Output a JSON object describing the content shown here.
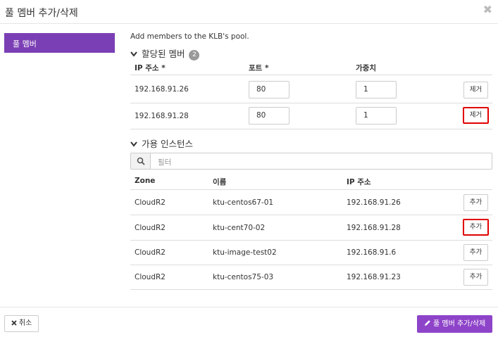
{
  "dialog": {
    "title": "풀 멤버 추가/삭제",
    "close_glyph": "✖",
    "sidebar_item": "풀 멤버",
    "description": "Add members to the KLB's pool."
  },
  "assigned": {
    "heading": "할당된 멤버",
    "count": "2",
    "headers": {
      "ip": "IP 주소 *",
      "port": "포트 *",
      "weight": "가중치"
    },
    "rows": [
      {
        "ip": "192.168.91.26",
        "port": "80",
        "weight": "1",
        "action": "제거"
      },
      {
        "ip": "192.168.91.28",
        "port": "80",
        "weight": "1",
        "action": "제거"
      }
    ]
  },
  "available": {
    "heading": "가용 인스턴스",
    "filter_placeholder": "필터",
    "headers": {
      "zone": "Zone",
      "name": "이름",
      "ip": "IP 주소"
    },
    "rows": [
      {
        "zone": "CloudR2",
        "name": "ktu-centos67-01",
        "ip": "192.168.91.26",
        "action": "추가"
      },
      {
        "zone": "CloudR2",
        "name": "ktu-cent70-02",
        "ip": "192.168.91.28",
        "action": "추가"
      },
      {
        "zone": "CloudR2",
        "name": "ktu-image-test02",
        "ip": "192.168.91.6",
        "action": "추가"
      },
      {
        "zone": "CloudR2",
        "name": "ktu-centos75-03",
        "ip": "192.168.91.23",
        "action": "추가"
      }
    ]
  },
  "footer": {
    "cancel_label": "취소",
    "submit_label": "풀 멤버 추가/삭제"
  },
  "colors": {
    "accent": "#8e44c9",
    "sidebar_active": "#7b3fb5",
    "highlight": "#e00000"
  },
  "icons": [
    "close-icon",
    "chevron-down-icon",
    "search-icon",
    "x-icon",
    "pencil-icon"
  ]
}
